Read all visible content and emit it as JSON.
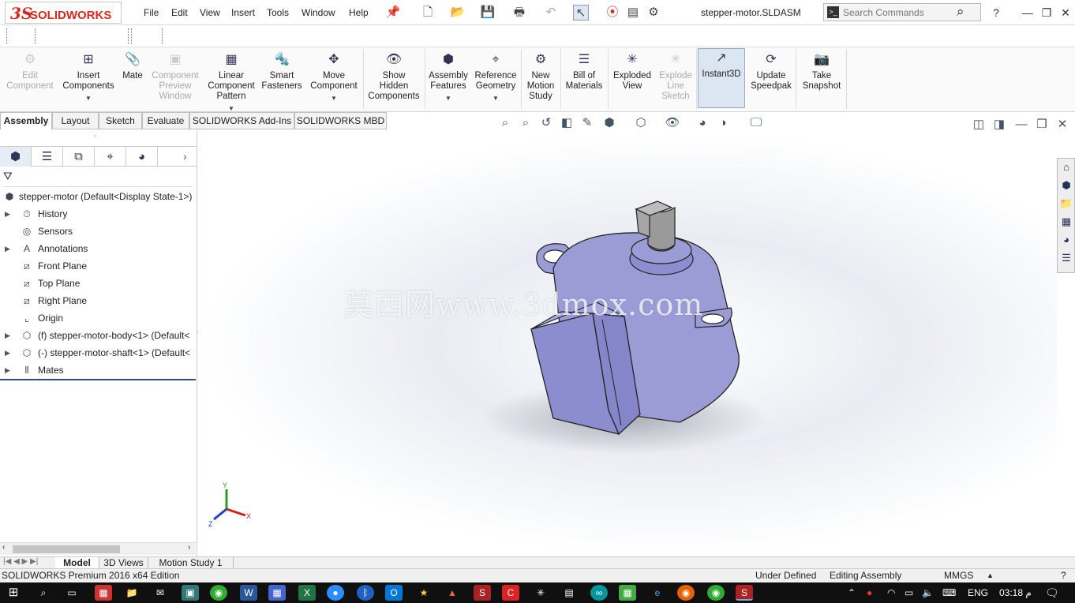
{
  "app": {
    "logo_ds": "3S",
    "logo_text": "SOLIDWORKS",
    "doc_title": "stepper-motor.SLDASM"
  },
  "menu": [
    "File",
    "Edit",
    "View",
    "Insert",
    "Tools",
    "Window",
    "Help"
  ],
  "search": {
    "placeholder": "Search Commands"
  },
  "ribbon": [
    {
      "label": "Edit\nComponent",
      "icon": "edit-component-icon",
      "glyph": "⚙",
      "disabled": true
    },
    {
      "label": "Insert\nComponents",
      "icon": "insert-components-icon",
      "glyph": "⊞",
      "arrow": true
    },
    {
      "label": "Mate",
      "icon": "mate-icon",
      "glyph": "📎"
    },
    {
      "label": "Component\nPreview\nWindow",
      "icon": "preview-window-icon",
      "glyph": "▣",
      "disabled": true
    },
    {
      "label": "Linear\nComponent\nPattern",
      "icon": "linear-pattern-icon",
      "glyph": "▦",
      "arrow": true
    },
    {
      "label": "Smart\nFasteners",
      "icon": "smart-fasteners-icon",
      "glyph": "🔩"
    },
    {
      "label": "Move\nComponent",
      "icon": "move-component-icon",
      "glyph": "✥",
      "arrow": true
    },
    {
      "label": "Show\nHidden\nComponents",
      "icon": "show-hidden-icon",
      "glyph": "👁"
    },
    {
      "label": "Assembly\nFeatures",
      "icon": "assembly-features-icon",
      "glyph": "⬢",
      "arrow": true
    },
    {
      "label": "Reference\nGeometry",
      "icon": "reference-geometry-icon",
      "glyph": "⌖",
      "arrow": true
    },
    {
      "label": "New\nMotion\nStudy",
      "icon": "motion-study-icon",
      "glyph": "⚙"
    },
    {
      "label": "Bill of\nMaterials",
      "icon": "bom-icon",
      "glyph": "☰"
    },
    {
      "label": "Exploded\nView",
      "icon": "exploded-view-icon",
      "glyph": "✳"
    },
    {
      "label": "Explode\nLine\nSketch",
      "icon": "explode-line-icon",
      "glyph": "✳",
      "disabled": true
    },
    {
      "label": "Instant3D",
      "icon": "instant3d-icon",
      "glyph": "↗",
      "active": true
    },
    {
      "label": "Update\nSpeedpak",
      "icon": "speedpak-icon",
      "glyph": "⟳"
    },
    {
      "label": "Take\nSnapshot",
      "icon": "camera-icon",
      "glyph": "📷"
    }
  ],
  "tabs": [
    "Assembly",
    "Layout",
    "Sketch",
    "Evaluate",
    "SOLIDWORKS Add-Ins",
    "SOLIDWORKS MBD"
  ],
  "tree": {
    "root": "stepper-motor  (Default<Display State-1>)",
    "items": [
      {
        "label": "History",
        "icon": "history-icon",
        "glyph": "⏱",
        "expand": true
      },
      {
        "label": "Sensors",
        "icon": "sensors-icon",
        "glyph": "◎"
      },
      {
        "label": "Annotations",
        "icon": "annotations-icon",
        "glyph": "A",
        "expand": true
      },
      {
        "label": "Front Plane",
        "icon": "plane-icon",
        "glyph": "⧄"
      },
      {
        "label": "Top Plane",
        "icon": "plane-icon",
        "glyph": "⧄"
      },
      {
        "label": "Right Plane",
        "icon": "plane-icon",
        "glyph": "⧄"
      },
      {
        "label": "Origin",
        "icon": "origin-icon",
        "glyph": "⌞"
      },
      {
        "label": "(f) stepper-motor-body<1> (Default<",
        "icon": "part-icon",
        "glyph": "⬡",
        "expand": true
      },
      {
        "label": "(-) stepper-motor-shaft<1> (Default<",
        "icon": "part-icon",
        "glyph": "⬡",
        "expand": true
      },
      {
        "label": "Mates",
        "icon": "mates-icon",
        "glyph": "⫴",
        "expand": true
      }
    ]
  },
  "watermark": "莫西网www.3dmox.com",
  "triad": {
    "x": "X",
    "y": "Y",
    "z": "Z"
  },
  "bottom_tabs": [
    "Model",
    "3D Views",
    "Motion Study 1"
  ],
  "status": {
    "edition": "SOLIDWORKS Premium 2016 x64 Edition",
    "state": "Under Defined",
    "mode": "Editing Assembly",
    "units": "MMGS"
  },
  "tray": {
    "lang": "ENG",
    "time": "03:18 م"
  },
  "colors": {
    "part": "#9b9cd6",
    "part_dark": "#7e7fbd",
    "shaft": "#9a9a9a",
    "accent": "#d52b1e"
  }
}
